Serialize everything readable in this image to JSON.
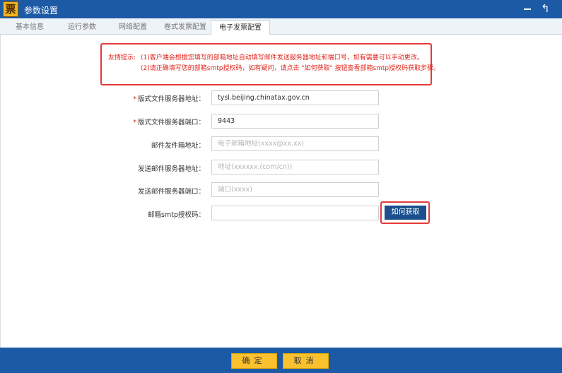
{
  "window": {
    "logo_text": "票",
    "title": "参数设置"
  },
  "tabs": [
    {
      "label": "基本信息",
      "active": false
    },
    {
      "label": "运行参数",
      "active": false
    },
    {
      "label": "网络配置",
      "active": false
    },
    {
      "label": "卷式发票配置",
      "active": false
    },
    {
      "label": "电子发票配置",
      "active": true
    }
  ],
  "notice": {
    "prefix": "友情提示:",
    "line1": "(1)客户端会根据您填写的部箱地址自动填写邮件发送服务器地址和端口号，如有需要可以手动更改。",
    "line2": "(2)请正确填写您的部箱smtp授权码，如有疑问，请点击 \"如何获取\" 按钮查看部箱smtp授权码获取步骤。"
  },
  "form": {
    "format_server_address": {
      "label": "版式文件服务器地址：",
      "required": true,
      "value": "tysl.beijing.chinatax.gov.cn"
    },
    "format_server_port": {
      "label": "版式文件服务器端口：",
      "required": true,
      "value": "9443"
    },
    "sender_email": {
      "label": "邮件发件箱地址：",
      "required": false,
      "placeholder": "电子邮箱地址(xxxx@xx.xx)"
    },
    "smtp_server_address": {
      "label": "发送邮件服务器地址：",
      "required": false,
      "placeholder": "地址(xxxxxx.(com/cn))"
    },
    "smtp_server_port": {
      "label": "发送邮件服务器端口：",
      "required": false,
      "placeholder": "端口(xxxx)"
    },
    "smtp_auth_code": {
      "label": "邮箱smtp授权码：",
      "required": false,
      "value": ""
    }
  },
  "help_button": "如何获取",
  "footer": {
    "confirm": "确定",
    "cancel": "取消"
  },
  "colors": {
    "title_bar": "#1c5aa6",
    "accent_yellow": "#fbc02d",
    "warning_red": "#e53a3a"
  }
}
